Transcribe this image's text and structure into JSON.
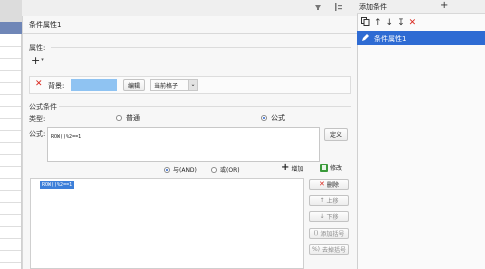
{
  "window_bar": {
    "pin_icon": "pin-icon",
    "dock_icon": "dock-icon"
  },
  "right_panel": {
    "title": "添加条件",
    "add_symbol": "+",
    "toolbar_icons": [
      "copy-icon",
      "arrow-up-icon",
      "arrow-down-icon",
      "sort-icon",
      "delete-icon"
    ],
    "items": [
      {
        "label": "条件属性1",
        "selected": true
      }
    ]
  },
  "dialog": {
    "title": "条件属性1",
    "properties": {
      "label": "属性:",
      "add_symbol": "+",
      "row": {
        "label": "背景:",
        "color": "#8fc3f2",
        "edit_label": "编辑",
        "scope_value": "当前格子"
      }
    },
    "formula_condition": {
      "label": "公式条件",
      "type_label": "类型:",
      "type_options": [
        {
          "label": "普通",
          "checked": false
        },
        {
          "label": "公式",
          "checked": true
        }
      ],
      "formula_label": "公式:",
      "formula_value": "ROW()%2==1",
      "define_label": "定义",
      "logic_options": [
        {
          "label": "与(AND)",
          "checked": true
        },
        {
          "label": "或(OR)",
          "checked": false
        }
      ],
      "add_label": "增加",
      "modify_label": "修改",
      "list_items": [
        "ROW()%2==1"
      ],
      "side_buttons": {
        "delete": "删除",
        "move_up": "上移",
        "move_down": "下移",
        "add_paren": "添加括号",
        "remove_paren": "去掉括号"
      }
    }
  },
  "colors": {
    "accent": "#2e6bd3",
    "delete_red": "#d9261c",
    "selection_blue": "#3d7fd9"
  }
}
